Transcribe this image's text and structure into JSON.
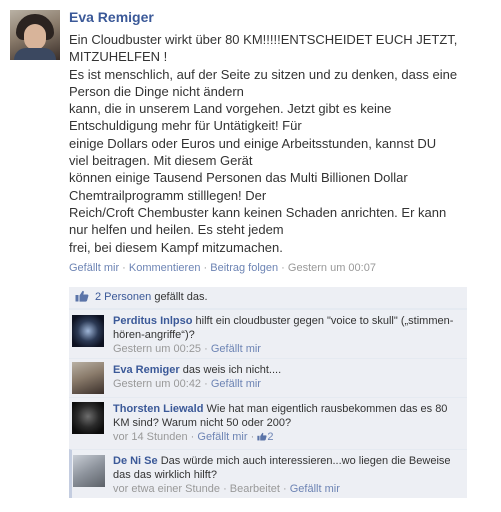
{
  "post": {
    "author": "Eva Remiger",
    "message_lines": [
      "Ein Cloudbuster wirkt über 80 KM!!!!!ENTSCHEIDET EUCH JETZT,",
      "MITZUHELFEN !",
      "Es ist menschlich, auf der Seite zu sitzen und zu denken, dass eine",
      "Person die Dinge nicht ändern",
      "kann, die in unserem Land vorgehen. Jetzt gibt es keine",
      "Entschuldigung mehr für Untätigkeit! Für",
      "einige Dollars oder Euros und einige Arbeitsstunden, kannst DU",
      "viel beitragen. Mit diesem Gerät",
      "können einige Tausend Personen das Multi Billionen Dollar",
      "Chemtrailprogramm stilllegen! Der",
      "Reich/Croft Chembuster kann keinen Schaden anrichten. Er kann",
      "nur helfen und heilen. Es steht jedem",
      "frei, bei diesem Kampf mitzumachen."
    ],
    "actions": {
      "like": "Gefällt mir",
      "comment": "Kommentieren",
      "follow": "Beitrag folgen",
      "time": "Gestern um 00:07",
      "sep": " · "
    }
  },
  "likes": {
    "count_link": "2 Personen",
    "text": " gefällt das."
  },
  "comments": [
    {
      "author": "Perditus Inlpso",
      "text": " hilft ein cloudbuster gegen \"voice to skull\" („stimmen-hören-angriffe“)?",
      "time": "Gestern um 00:25",
      "like": "Gefällt mir"
    },
    {
      "author": "Eva Remiger",
      "text": " das weis ich nicht....",
      "time": "Gestern um 00:42",
      "like": "Gefällt mir"
    },
    {
      "author": "Thorsten Liewald",
      "text": " Wie hat man eigentlich rausbekommen das es 80 KM sind? Warum nicht 50 oder 200?",
      "time": "vor 14 Stunden",
      "like": "Gefällt mir",
      "like_count": "2"
    },
    {
      "author": "De Ni Se",
      "text": " Das würde mich auch interessieren...wo liegen die Beweise das das wirklich hilft?",
      "time": "vor etwa einer Stunde",
      "edited": "Bearbeitet",
      "like": "Gefällt mir"
    }
  ],
  "colors": {
    "link": "#3b5998",
    "meta_link": "#6d84b4",
    "ufi_bg": "#edeff4"
  },
  "icons": [
    "like-thumb-icon",
    "avatar-photo"
  ]
}
